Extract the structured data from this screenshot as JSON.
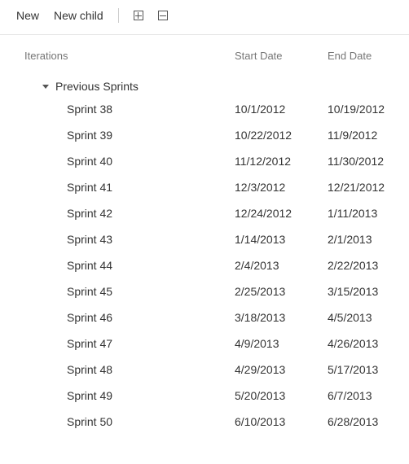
{
  "toolbar": {
    "new_label": "New",
    "new_child_label": "New child",
    "expand_all_icon": "plus-box-icon",
    "collapse_all_icon": "minus-box-icon"
  },
  "columns": {
    "iterations": "Iterations",
    "start_date": "Start Date",
    "end_date": "End Date"
  },
  "group": {
    "label": "Previous Sprints",
    "expanded": true
  },
  "sprints": [
    {
      "name": "Sprint 38",
      "start": "10/1/2012",
      "end": "10/19/2012"
    },
    {
      "name": "Sprint 39",
      "start": "10/22/2012",
      "end": "11/9/2012"
    },
    {
      "name": "Sprint 40",
      "start": "11/12/2012",
      "end": "11/30/2012"
    },
    {
      "name": "Sprint 41",
      "start": "12/3/2012",
      "end": "12/21/2012"
    },
    {
      "name": "Sprint 42",
      "start": "12/24/2012",
      "end": "1/11/2013"
    },
    {
      "name": "Sprint 43",
      "start": "1/14/2013",
      "end": "2/1/2013"
    },
    {
      "name": "Sprint 44",
      "start": "2/4/2013",
      "end": "2/22/2013"
    },
    {
      "name": "Sprint 45",
      "start": "2/25/2013",
      "end": "3/15/2013"
    },
    {
      "name": "Sprint 46",
      "start": "3/18/2013",
      "end": "4/5/2013"
    },
    {
      "name": "Sprint 47",
      "start": "4/9/2013",
      "end": "4/26/2013"
    },
    {
      "name": "Sprint 48",
      "start": "4/29/2013",
      "end": "5/17/2013"
    },
    {
      "name": "Sprint 49",
      "start": "5/20/2013",
      "end": "6/7/2013"
    },
    {
      "name": "Sprint 50",
      "start": "6/10/2013",
      "end": "6/28/2013"
    }
  ]
}
